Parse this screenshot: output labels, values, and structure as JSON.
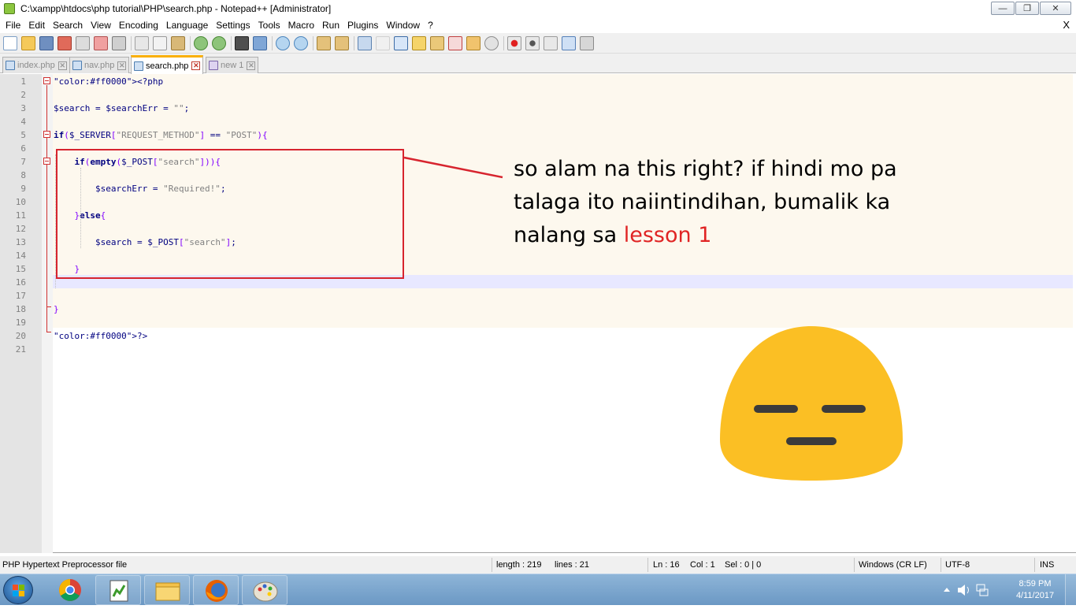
{
  "window": {
    "title": "C:\\xampp\\htdocs\\php tutorial\\PHP\\search.php - Notepad++ [Administrator]",
    "minimize": "—",
    "restore": "❐",
    "close": "✕"
  },
  "menu": {
    "items": [
      "File",
      "Edit",
      "Search",
      "View",
      "Encoding",
      "Language",
      "Settings",
      "Tools",
      "Macro",
      "Run",
      "Plugins",
      "Window",
      "?"
    ],
    "close": "X"
  },
  "tabs": [
    {
      "label": "index.php",
      "active": false
    },
    {
      "label": "nav.php",
      "active": false
    },
    {
      "label": "search.php",
      "active": true
    },
    {
      "label": "new 1",
      "active": false
    }
  ],
  "editor": {
    "line_numbers": [
      "1",
      "2",
      "3",
      "4",
      "5",
      "6",
      "7",
      "8",
      "9",
      "10",
      "11",
      "12",
      "13",
      "14",
      "15",
      "16",
      "17",
      "18",
      "19",
      "20",
      "21"
    ],
    "lines": [
      "<?php",
      "",
      "$search = $searchErr = \"\";",
      "",
      "if($_SERVER[\"REQUEST_METHOD\"] == \"POST\"){",
      "",
      "    if(empty($_POST[\"search\"])){",
      "",
      "        $searchErr = \"Required!\";",
      "",
      "    }else{",
      "",
      "        $search = $_POST[\"search\"];",
      "",
      "    }",
      "",
      "",
      "}",
      "",
      "?>",
      ""
    ],
    "current_line": 16
  },
  "annotation": {
    "text_main": "so alam na this right? if hindi mo pa talaga ito naiintindihan, bumalik ka nalang sa ",
    "text_highlight": "lesson 1",
    "box_color": "#d7242e",
    "highlight_color": "#e02424"
  },
  "emoji": {
    "name": "expressionless-face",
    "color": "#fbbf24"
  },
  "status": {
    "file_type": "PHP Hypertext Preprocessor file",
    "length": "length : 219",
    "lines": "lines : 21",
    "ln": "Ln : 16",
    "col": "Col : 1",
    "sel": "Sel : 0 | 0",
    "eol": "Windows (CR LF)",
    "encoding": "UTF-8",
    "mode": "INS"
  },
  "taskbar": {
    "apps": [
      "chrome-icon",
      "notepadpp-icon",
      "explorer-icon",
      "firefox-icon",
      "paint-icon"
    ],
    "time": "8:59 PM",
    "date": "4/11/2017"
  }
}
